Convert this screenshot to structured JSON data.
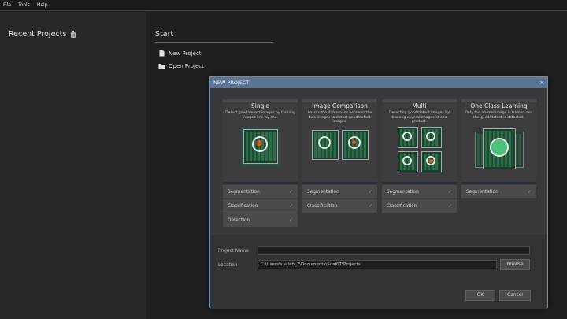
{
  "menu": [
    "File",
    "Tools",
    "Help"
  ],
  "recent": {
    "title": "Recent Projects"
  },
  "start": {
    "title": "Start",
    "items": [
      {
        "label": "New Project",
        "icon": "new-file-icon"
      },
      {
        "label": "Open Project",
        "icon": "folder-icon"
      }
    ]
  },
  "dialog": {
    "title": "NEW PROJECT",
    "close_label": "×",
    "project_types": [
      {
        "name": "Single",
        "description": "Detect good/defect images by training images one by one.",
        "features": [
          "Segmentation",
          "Classification",
          "Detection"
        ]
      },
      {
        "name": "Image Comparison",
        "description": "Learns the differences between the two images to detect good/defect images.",
        "features": [
          "Segmentation",
          "Classification"
        ]
      },
      {
        "name": "Multi",
        "description": "Detecting good/defect images by training several images of one product.",
        "features": [
          "Segmentation",
          "Classification"
        ]
      },
      {
        "name": "One Class Learning",
        "description": "Only the normal image is trained and the good/defect is detected.",
        "features": [
          "Segmentation"
        ]
      }
    ],
    "check_glyph": "✓",
    "fields": {
      "project_name_label": "Project Name",
      "project_name_value": "",
      "location_label": "Location",
      "location_value": "C:\\Users\\sualab_2\\Documents\\SuaKIT\\Projects"
    },
    "buttons": {
      "browse": "Browse",
      "ok": "OK",
      "cancel": "Cancel"
    }
  },
  "colors": {
    "accent": "#3d6fa7",
    "dialog_header": "#5a7596",
    "defect": "#e0572f",
    "good": "#4cc27a"
  }
}
